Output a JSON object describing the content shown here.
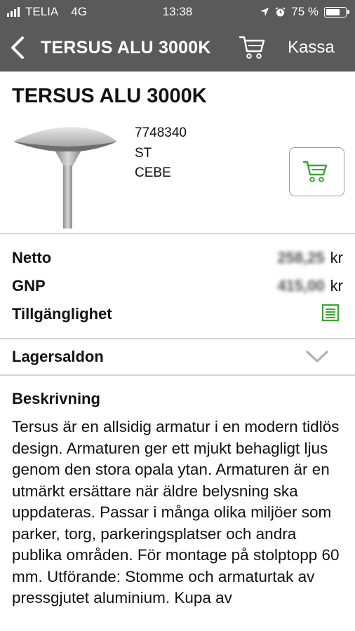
{
  "status_bar": {
    "carrier": "TELIA",
    "network": "4G",
    "time": "13:38",
    "battery": "75 %"
  },
  "nav": {
    "title": "TERSUS ALU 3000K",
    "checkout_label": "Kassa"
  },
  "product": {
    "title": "TERSUS ALU 3000K",
    "article_number": "7748340",
    "unit": "ST",
    "brand": "CEBE"
  },
  "prices": {
    "netto_label": "Netto",
    "netto_value": "258,25",
    "netto_currency": "kr",
    "gnp_label": "GNP",
    "gnp_value": "415,00",
    "gnp_currency": "kr",
    "availability_label": "Tillgänglighet"
  },
  "stock": {
    "label": "Lagersaldon"
  },
  "description": {
    "heading": "Beskrivning",
    "text": "Tersus är en allsidig armatur i en modern tidlös design. Armaturen ger ett mjukt behagligt ljus genom den stora opala ytan. Armaturen är en utmärkt ersättare när äldre belysning ska uppdateras. Passar i många olika miljöer som parker, torg, parkeringsplatser och andra publika områden. För montage på stolptopp 60 mm. Utförande: Stomme och armaturtak av pressgjutet aluminium. Kupa av"
  },
  "colors": {
    "navbar": "#5a5a5a",
    "accent_green": "#3aa635",
    "divider": "#d4d4d4"
  },
  "icons": {
    "back": "chevron-left-icon",
    "cart": "cart-icon",
    "add_to_cart": "cart-icon",
    "availability": "list-icon",
    "expand": "chevron-down-icon"
  }
}
